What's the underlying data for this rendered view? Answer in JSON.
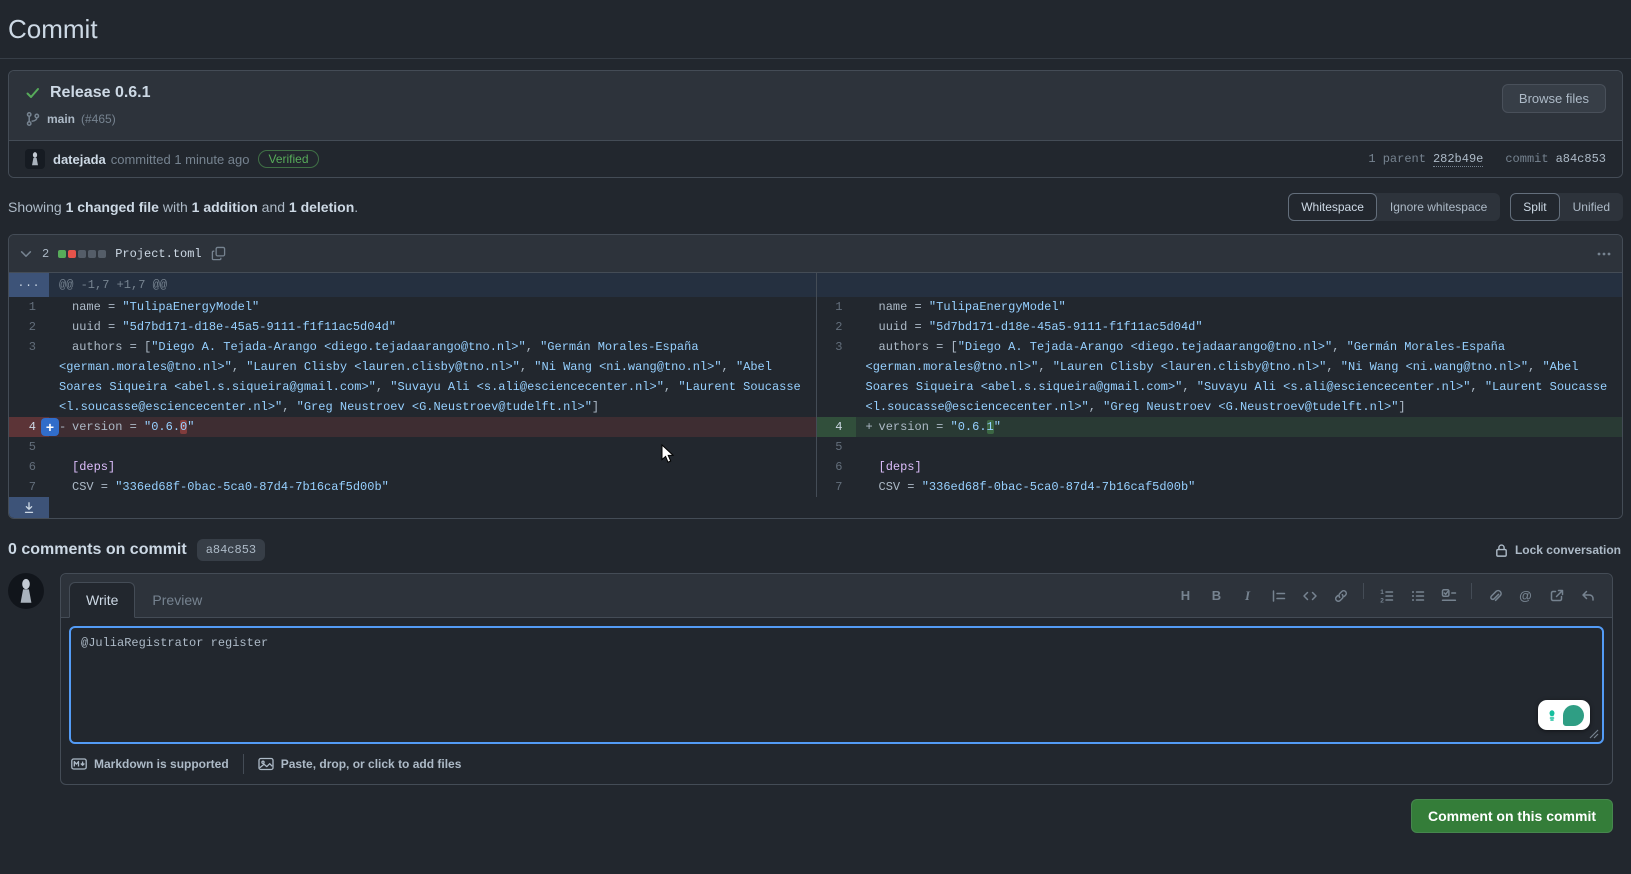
{
  "page": {
    "title": "Commit"
  },
  "commit": {
    "title": "Release 0.6.1",
    "branch": "main",
    "branch_ref": "(#465)",
    "author": "datejada",
    "action_text": "committed 1 minute ago",
    "verified_badge": "Verified",
    "browse_files": "Browse files",
    "parent_label": "1 parent",
    "parent_hash": "282b49e",
    "commit_label": "commit",
    "commit_hash": "a84c853"
  },
  "summary": {
    "showing": "Showing ",
    "changed_file": "1 changed file",
    "with": " with ",
    "addition": "1 addition",
    "and": " and ",
    "deletion": "1 deletion",
    "period": "."
  },
  "controls": {
    "whitespace": "Whitespace",
    "ignore_whitespace": "Ignore whitespace",
    "split": "Split",
    "unified": "Unified"
  },
  "file": {
    "changes_count": "2",
    "blocks": [
      "add",
      "del",
      "neutral",
      "neutral",
      "neutral"
    ],
    "name": "Project.toml"
  },
  "diff": {
    "rows": [
      {
        "kind": "hunk",
        "gutter_label": "...",
        "text": "@@ -1,7 +1,7 @@"
      },
      {
        "kind": "code",
        "left": {
          "num": "1",
          "type": "context",
          "marker": "",
          "segs": [
            [
              "name",
              "k"
            ],
            [
              " = ",
              "p"
            ],
            [
              "\"TulipaEnergyModel\"",
              "s"
            ]
          ]
        },
        "right": {
          "num": "1",
          "type": "context",
          "marker": "",
          "segs": [
            [
              "name",
              "k"
            ],
            [
              " = ",
              "p"
            ],
            [
              "\"TulipaEnergyModel\"",
              "s"
            ]
          ]
        }
      },
      {
        "kind": "code",
        "left": {
          "num": "2",
          "type": "context",
          "marker": "",
          "segs": [
            [
              "uuid",
              "k"
            ],
            [
              " = ",
              "p"
            ],
            [
              "\"5d7bd171-d18e-45a5-9111-f1f11ac5d04d\"",
              "s"
            ]
          ]
        },
        "right": {
          "num": "2",
          "type": "context",
          "marker": "",
          "segs": [
            [
              "uuid",
              "k"
            ],
            [
              " = ",
              "p"
            ],
            [
              "\"5d7bd171-d18e-45a5-9111-f1f11ac5d04d\"",
              "s"
            ]
          ]
        }
      },
      {
        "kind": "code",
        "left": {
          "num": "3",
          "type": "context",
          "marker": "",
          "segs": [
            [
              "authors",
              "k"
            ],
            [
              " = [",
              "p"
            ],
            [
              "\"Diego A. Tejada-Arango <diego.tejadaarango@tno.nl>\"",
              "s"
            ],
            [
              ", ",
              "p"
            ],
            [
              "\"Germán Morales-España <german.morales@tno.nl>\"",
              "s"
            ],
            [
              ", ",
              "p"
            ],
            [
              "\"Lauren Clisby <lauren.clisby@tno.nl>\"",
              "s"
            ],
            [
              ", ",
              "p"
            ],
            [
              "\"Ni Wang <ni.wang@tno.nl>\"",
              "s"
            ],
            [
              ", ",
              "p"
            ],
            [
              "\"Abel Soares Siqueira <abel.s.siqueira@gmail.com>\"",
              "s"
            ],
            [
              ", ",
              "p"
            ],
            [
              "\"Suvayu Ali <s.ali@esciencecenter.nl>\"",
              "s"
            ],
            [
              ", ",
              "p"
            ],
            [
              "\"Laurent Soucasse <l.soucasse@esciencecenter.nl>\"",
              "s"
            ],
            [
              ", ",
              "p"
            ],
            [
              "\"Greg Neustroev <G.Neustroev@tudelft.nl>\"",
              "s"
            ],
            [
              "]",
              "p"
            ]
          ]
        },
        "right": {
          "num": "3",
          "type": "context",
          "marker": "",
          "segs": [
            [
              "authors",
              "k"
            ],
            [
              " = [",
              "p"
            ],
            [
              "\"Diego A. Tejada-Arango <diego.tejadaarango@tno.nl>\"",
              "s"
            ],
            [
              ", ",
              "p"
            ],
            [
              "\"Germán Morales-España <german.morales@tno.nl>\"",
              "s"
            ],
            [
              ", ",
              "p"
            ],
            [
              "\"Lauren Clisby <lauren.clisby@tno.nl>\"",
              "s"
            ],
            [
              ", ",
              "p"
            ],
            [
              "\"Ni Wang <ni.wang@tno.nl>\"",
              "s"
            ],
            [
              ", ",
              "p"
            ],
            [
              "\"Abel Soares Siqueira <abel.s.siqueira@gmail.com>\"",
              "s"
            ],
            [
              ", ",
              "p"
            ],
            [
              "\"Suvayu Ali <s.ali@esciencecenter.nl>\"",
              "s"
            ],
            [
              ", ",
              "p"
            ],
            [
              "\"Laurent Soucasse <l.soucasse@esciencecenter.nl>\"",
              "s"
            ],
            [
              ", ",
              "p"
            ],
            [
              "\"Greg Neustroev <G.Neustroev@tudelft.nl>\"",
              "s"
            ],
            [
              "]",
              "p"
            ]
          ]
        }
      },
      {
        "kind": "code",
        "left": {
          "num": "4",
          "type": "del",
          "marker": "-",
          "plus": true,
          "segs": [
            [
              "version",
              "k"
            ],
            [
              " = ",
              "p"
            ],
            [
              "\"0.6.",
              "s"
            ],
            [
              "0",
              "s hl-del"
            ],
            [
              "\"",
              "s"
            ]
          ]
        },
        "right": {
          "num": "4",
          "type": "add",
          "marker": "+",
          "segs": [
            [
              "version",
              "k"
            ],
            [
              " = ",
              "p"
            ],
            [
              "\"0.6.",
              "s"
            ],
            [
              "1",
              "s hl-add"
            ],
            [
              "\"",
              "s"
            ]
          ]
        }
      },
      {
        "kind": "code",
        "left": {
          "num": "5",
          "type": "context",
          "marker": "",
          "segs": []
        },
        "right": {
          "num": "5",
          "type": "context",
          "marker": "",
          "segs": []
        }
      },
      {
        "kind": "code",
        "left": {
          "num": "6",
          "type": "context",
          "marker": "",
          "segs": [
            [
              "[deps]",
              "e"
            ]
          ]
        },
        "right": {
          "num": "6",
          "type": "context",
          "marker": "",
          "segs": [
            [
              "[deps]",
              "e"
            ]
          ]
        }
      },
      {
        "kind": "code",
        "left": {
          "num": "7",
          "type": "context",
          "marker": "",
          "segs": [
            [
              "CSV",
              "k"
            ],
            [
              " = ",
              "p"
            ],
            [
              "\"336ed68f-0bac-5ca0-87d4-7b16caf5d00b\"",
              "s"
            ]
          ]
        },
        "right": {
          "num": "7",
          "type": "context",
          "marker": "",
          "segs": [
            [
              "CSV",
              "k"
            ],
            [
              " = ",
              "p"
            ],
            [
              "\"336ed68f-0bac-5ca0-87d4-7b16caf5d00b\"",
              "s"
            ]
          ]
        }
      },
      {
        "kind": "expander"
      }
    ]
  },
  "comments": {
    "heading": "0 comments on commit",
    "hash": "a84c853",
    "lock": "Lock conversation"
  },
  "comment_form": {
    "tabs": [
      "Write",
      "Preview"
    ],
    "active_tab": "Write",
    "toolbar": [
      "heading",
      "bold",
      "italic",
      "quote",
      "code",
      "link",
      "numbered-list",
      "bulleted-list",
      "task-list",
      "paperclip",
      "mention",
      "cross-reference",
      "reply"
    ],
    "textarea_value": "@JuliaRegistrator register",
    "markdown_note": "Markdown is supported",
    "attach_note": "Paste, drop, or click to add files",
    "submit": "Comment on this commit"
  },
  "colors": {
    "accent": "#539bf5",
    "success": "#57ab5a",
    "danger": "#e5534b",
    "green_button": "#347d39",
    "string": "#96d0ff",
    "purple": "#dcbdfb"
  }
}
